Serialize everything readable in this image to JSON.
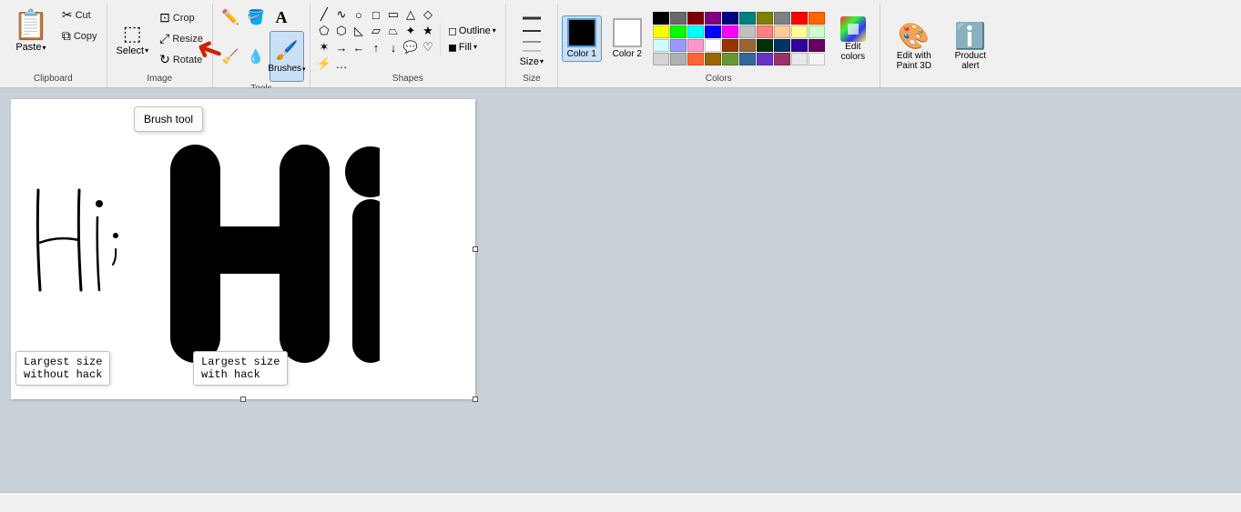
{
  "ribbon": {
    "groups": {
      "clipboard": {
        "label": "Clipboard",
        "paste_label": "Paste",
        "cut_label": "Cut",
        "copy_label": "Copy"
      },
      "image": {
        "label": "Image",
        "crop_label": "Crop",
        "resize_label": "Resize",
        "rotate_label": "Rotate",
        "select_label": "Select"
      },
      "tools": {
        "label": "Tools",
        "brushes_label": "Brushes",
        "text_label": "A"
      },
      "shapes": {
        "label": "Shapes",
        "outline_label": "Outline",
        "fill_label": "Fill"
      },
      "size": {
        "label": "Size",
        "size_label": "Size"
      },
      "colors": {
        "label": "Colors",
        "color1_label": "Color 1",
        "color2_label": "Color 2",
        "edit_colors_label": "Edit colors"
      },
      "actions": {
        "edit_paint3d_label": "Edit with Paint 3D",
        "product_alert_label": "Product alert"
      }
    }
  },
  "tooltip": {
    "brush_tool": "Brush tool"
  },
  "canvas": {
    "label_small": "Largest size\nwithout hack",
    "label_large": "Largest size\nwith hack"
  },
  "colors": {
    "swatches": [
      "#000000",
      "#696969",
      "#800000",
      "#800080",
      "#000080",
      "#008080",
      "#808000",
      "#808080",
      "#ff0000",
      "#ff6600",
      "#ffff00",
      "#00ff00",
      "#00ffff",
      "#0000ff",
      "#ff00ff",
      "#c0c0c0",
      "#ff8080",
      "#ffcc99",
      "#ffff99",
      "#ccffcc",
      "#ccffff",
      "#9999ff",
      "#ff99cc",
      "#ffffff",
      "#993300",
      "#996633",
      "#003300",
      "#003366",
      "#330099",
      "#660066",
      "#d4d4d4",
      "#b0b0b0",
      "#ff6633",
      "#996600",
      "#669933",
      "#336699",
      "#6633cc",
      "#993366",
      "#e8e8e8",
      "#f5f5f5"
    ],
    "color1": "#000000",
    "color2": "#ffffff"
  },
  "status": ""
}
